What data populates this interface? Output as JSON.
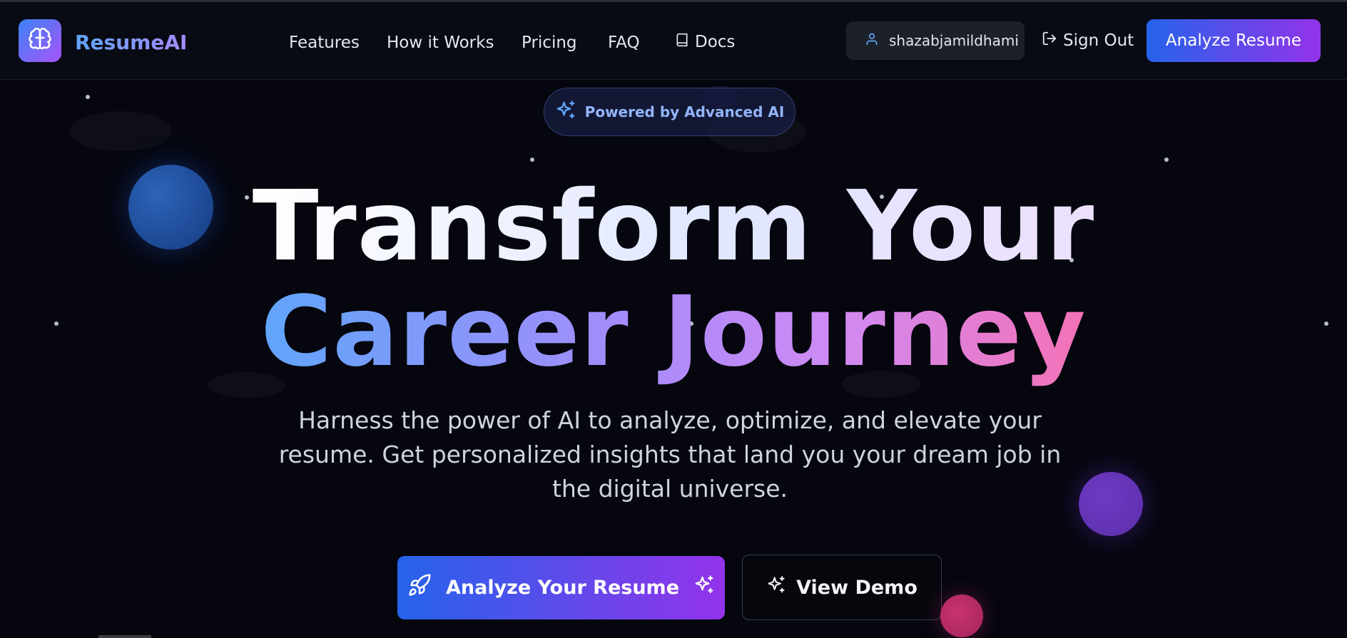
{
  "header": {
    "brand_name": "ResumeAI",
    "nav": {
      "features": "Features",
      "how_it_works": "How it Works",
      "pricing": "Pricing",
      "faq": "FAQ",
      "docs": "Docs"
    },
    "username": "shazabjamildhami",
    "sign_out": "Sign Out",
    "analyze_button": "Analyze Resume"
  },
  "hero": {
    "badge": "Powered by Advanced AI",
    "headline_line1": "Transform Your",
    "headline_line2": "Career Journey",
    "subtext": "Harness the power of AI to analyze, optimize, and elevate your resume. Get personalized insights that land you your dream job in the digital universe.",
    "primary_cta": "Analyze Your Resume",
    "secondary_cta": "View Demo"
  },
  "colors": {
    "accent_start": "#2563eb",
    "accent_end": "#9333ea",
    "background": "#05060e"
  },
  "icons": {
    "brand": "brain-icon",
    "docs": "book-icon",
    "user": "user-icon",
    "sign_out": "logout-icon",
    "badge": "sparkles-icon",
    "primary_cta": "rocket-icon",
    "primary_cta_trailing": "sparkles-icon",
    "secondary_cta": "sparkles-icon"
  }
}
